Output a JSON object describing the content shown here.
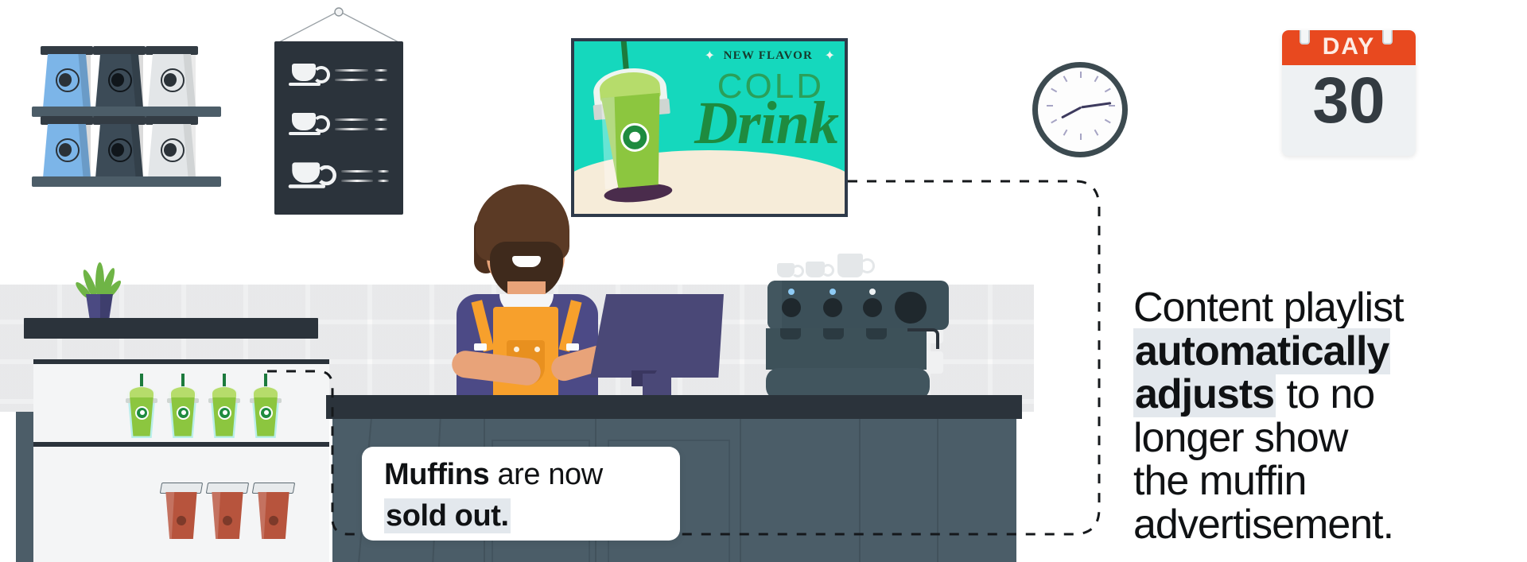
{
  "scene": {
    "title": "Coffee shop digital signage scene",
    "background_color": "#ffffff"
  },
  "signage_screen": {
    "name": "cold-drink-advertisement",
    "badge": "NEW FLAVOR",
    "headline_top": "COLD",
    "headline_main": "Drink",
    "bg_color": "#15d8bd",
    "sand_color": "#f6ecd9",
    "text_color": "#1e8b3f"
  },
  "calendar": {
    "label": "DAY",
    "number": "30",
    "header_color": "#e8491f",
    "body_color": "#eef1f3",
    "number_color": "#333b41"
  },
  "callout": {
    "line1_bold": "Muffins",
    "line1_rest": " are now",
    "line2": "sold out.",
    "highlight_color": "#e3e8ed"
  },
  "side_text": {
    "lines": [
      "Content playlist",
      "automatically",
      "adjusts to no",
      "longer show",
      "the muffin",
      "advertisement."
    ],
    "highlighted": [
      "automatically",
      "adjusts"
    ],
    "highlight_color": "#e3e8ed",
    "text_color": "#101214"
  },
  "menu_board": {
    "name": "hanging-chalkboard-menu",
    "rows": 3,
    "board_color": "#2b333b",
    "item_icon": "coffee-cup-icon"
  },
  "shelves": {
    "name": "coffee-bag-shelf",
    "bag_colors": [
      "#7cb5e8",
      "#3c4b57",
      "#e3e6e8"
    ],
    "rows": 2,
    "bags_per_row": 3,
    "board_color": "#4c5d68"
  },
  "clock": {
    "name": "wall-clock",
    "frame_color": "#3c4a50",
    "hour_hand_deg": -118,
    "minute_hand_deg": 82
  },
  "barista": {
    "name": "barista-character",
    "shirt_color": "#4c4a86",
    "apron_color": "#f7a02c",
    "skin_color": "#e8a379",
    "hair_color": "#5b3a25"
  },
  "espresso_machine": {
    "name": "espresso-machine",
    "body_color": "#3c5059",
    "led_colors": [
      "#8ecbf5",
      "#8ecbf5",
      "#eef2f4"
    ],
    "knob_count": 3
  },
  "display_fridge": {
    "name": "display-fridge",
    "top_shelf_item": "green-frappe-cup",
    "top_shelf_count": 4,
    "bottom_shelf_item": "hot-coffee-cup",
    "bottom_shelf_count": 3,
    "case_color": "#f4f5f6"
  },
  "counter": {
    "name": "service-counter",
    "top_color": "#2b333b",
    "body_color": "#4b5d68"
  },
  "monitor": {
    "name": "pos-monitor",
    "color": "#4a4877"
  },
  "plant": {
    "name": "potted-plant",
    "pot_color": "#4b4a82",
    "leaf_color": "#6fb446"
  },
  "connector": {
    "name": "dashed-connector-path",
    "color": "#15181b",
    "style": "dashed"
  }
}
